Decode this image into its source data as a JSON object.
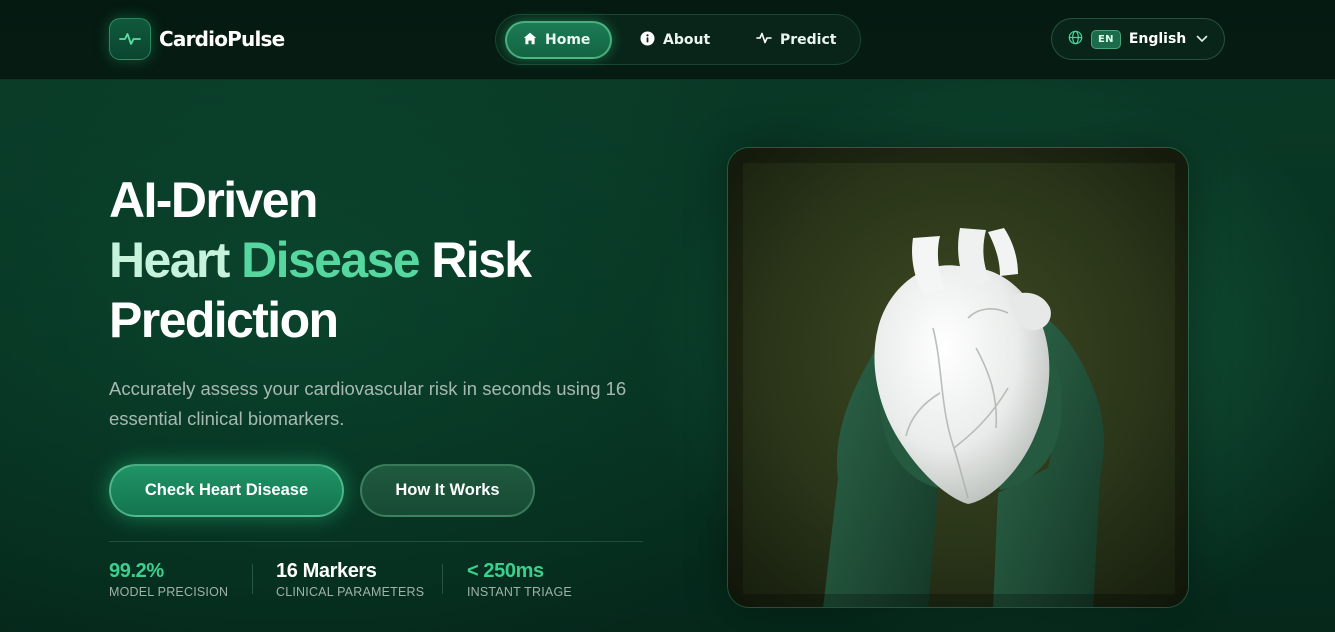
{
  "brand": {
    "name": "CardioPulse",
    "icon": "pulse-icon"
  },
  "nav": {
    "items": [
      {
        "label": "Home",
        "icon": "home-icon",
        "active": true
      },
      {
        "label": "About",
        "icon": "info-icon",
        "active": false
      },
      {
        "label": "Predict",
        "icon": "pulse-icon",
        "active": false
      }
    ]
  },
  "language": {
    "icon": "globe-icon",
    "code": "EN",
    "label": "English"
  },
  "hero": {
    "title_line1": "AI-Driven",
    "title_word_heart": "Heart",
    "title_word_disease": "Disease",
    "title_word_risk": "Risk",
    "title_line3": "Prediction",
    "description": "Accurately assess your cardiovascular risk in seconds using 16 essential clinical biomarkers.",
    "primary_cta": "Check Heart Disease",
    "secondary_cta": "How It Works",
    "image_subject": "white ceramic heart held in dark green gloved hands"
  },
  "stats": [
    {
      "value": "99.2%",
      "label": "MODEL PRECISION",
      "color": "#3ccf8e"
    },
    {
      "value": "16 Markers",
      "label": "CLINICAL PARAMETERS",
      "color": "#ffffff"
    },
    {
      "value": "< 250ms",
      "label": "INSTANT TRIAGE",
      "color": "#3ccf8e"
    }
  ],
  "colors": {
    "accent": "#3ccf8e",
    "accent_light": "#c6f3dc",
    "background": "#073221",
    "header": "#051a11"
  }
}
